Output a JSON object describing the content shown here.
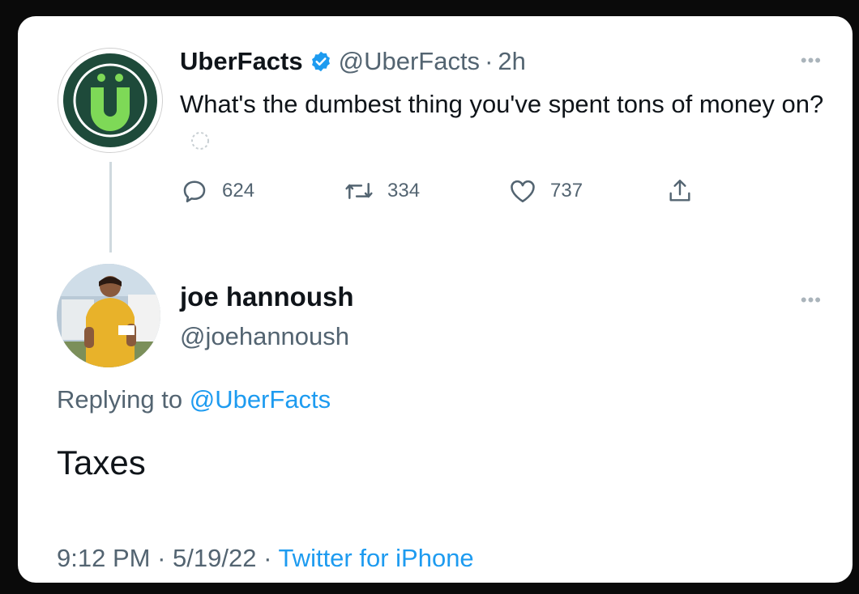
{
  "tweet": {
    "author_name": "UberFacts",
    "author_handle": "@UberFacts",
    "separator": "·",
    "time": "2h",
    "text": "What's the dumbest thing you've spent tons of money on?",
    "reply_count": "624",
    "retweet_count": "334",
    "like_count": "737"
  },
  "reply": {
    "author_name": "joe hannoush",
    "author_handle": "@joehannoush",
    "replying_prefix": "Replying to ",
    "replying_to": "@UberFacts",
    "text": "Taxes",
    "time": "9:12 PM",
    "date": "5/19/22",
    "source": "Twitter for iPhone",
    "sep": " · "
  },
  "icons": {
    "verified": "verified-badge-icon",
    "reply": "reply-icon",
    "retweet": "retweet-icon",
    "like": "heart-icon",
    "share": "share-icon",
    "more": "more-icon"
  },
  "colors": {
    "verified": "#1d9bf0",
    "link": "#1d9bf0",
    "avatar_bg": "#1e4a3a",
    "avatar_logo": "#7ed957"
  }
}
